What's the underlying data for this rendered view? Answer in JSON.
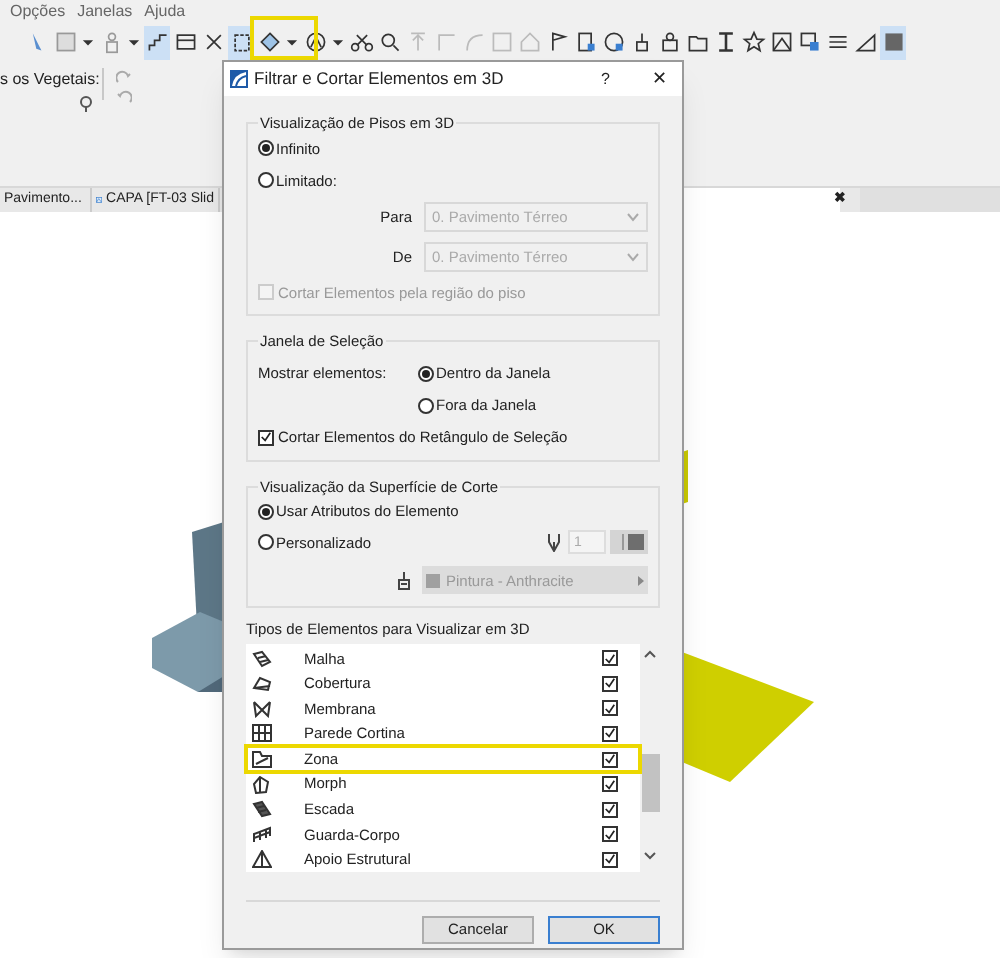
{
  "menu": [
    {
      "label": "Opções"
    },
    {
      "label": "Janelas"
    },
    {
      "label": "Ajuda"
    }
  ],
  "info_box": {
    "label": "s os Vegetais:"
  },
  "tabs": [
    {
      "label": "Pavimento...",
      "selected": false
    },
    {
      "label": "CAPA [FT-03 Slid",
      "selected": false
    }
  ],
  "tab_close": "✖",
  "dialog": {
    "title": "Filtrar e Cortar Elementos em 3D",
    "help": "?",
    "close": "✕",
    "floors": {
      "legend": "Visualização de Pisos em 3D",
      "options": [
        {
          "label": "Infinito",
          "selected": true
        },
        {
          "label": "Limitado:",
          "selected": false
        }
      ],
      "fields": [
        {
          "label": "Para",
          "value": "0. Pavimento Térreo",
          "disabled": true
        },
        {
          "label": "De",
          "value": "0. Pavimento Térreo",
          "disabled": true
        }
      ],
      "cut_by_floor": {
        "label": "Cortar Elementos pela região do piso",
        "checked": false,
        "disabled": true
      }
    },
    "selection": {
      "legend": "Janela de Seleção",
      "show_label": "Mostrar elementos:",
      "options": [
        {
          "label": "Dentro da Janela",
          "selected": true
        },
        {
          "label": "Fora da Janela",
          "selected": false
        }
      ],
      "cut_by_marquee": {
        "label": "Cortar Elementos do Retângulo de Seleção",
        "checked": true,
        "disabled": false
      }
    },
    "cut_surface": {
      "legend": "Visualização da Superfície de Corte",
      "options": [
        {
          "label": "Usar Atributos do Elemento",
          "selected": true
        },
        {
          "label": "Personalizado",
          "selected": false
        }
      ],
      "pen_value": "1",
      "fill_value": "Pintura - Anthracite",
      "disabled": true
    },
    "types": {
      "label": "Tipos de Elementos para Visualizar em 3D",
      "items": [
        {
          "label": "Malha",
          "checked": true,
          "highlighted": false
        },
        {
          "label": "Cobertura",
          "checked": true,
          "highlighted": false
        },
        {
          "label": "Membrana",
          "checked": true,
          "highlighted": false
        },
        {
          "label": "Parede Cortina",
          "checked": true,
          "highlighted": false
        },
        {
          "label": "Zona",
          "checked": true,
          "highlighted": true
        },
        {
          "label": "Morph",
          "checked": true,
          "highlighted": false
        },
        {
          "label": "Escada",
          "checked": true,
          "highlighted": false
        },
        {
          "label": "Guarda-Corpo",
          "checked": true,
          "highlighted": false
        },
        {
          "label": "Apoio Estrutural",
          "checked": true,
          "highlighted": false
        }
      ]
    },
    "buttons": [
      {
        "label": "Cancelar",
        "default": false
      },
      {
        "label": "OK",
        "default": true
      }
    ]
  }
}
